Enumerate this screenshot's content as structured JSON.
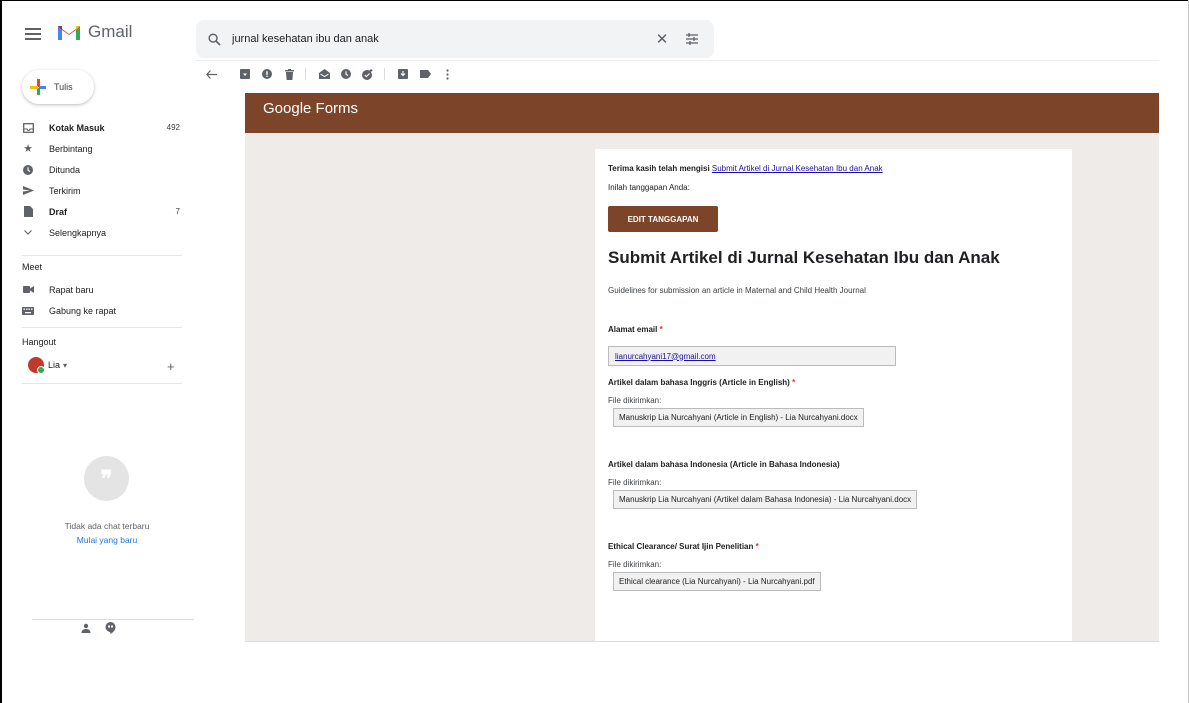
{
  "app": {
    "name": "Gmail"
  },
  "search": {
    "value": "jurnal kesehatan ibu dan anak"
  },
  "sidebar": {
    "compose_label": "Tulis",
    "items": [
      {
        "label": "Kotak Masuk",
        "count": "492",
        "icon": "inbox-icon",
        "bold": true
      },
      {
        "label": "Berbintang",
        "count": "",
        "icon": "star-icon",
        "bold": false
      },
      {
        "label": "Ditunda",
        "count": "",
        "icon": "clock-icon",
        "bold": false
      },
      {
        "label": "Terkirim",
        "count": "",
        "icon": "send-icon",
        "bold": false
      },
      {
        "label": "Draf",
        "count": "7",
        "icon": "draft-icon",
        "bold": true
      },
      {
        "label": "Selengkapnya",
        "count": "",
        "icon": "chevron-down-icon",
        "bold": false
      }
    ],
    "meet": {
      "title": "Meet",
      "items": [
        {
          "label": "Rapat baru",
          "icon": "video-icon"
        },
        {
          "label": "Gabung ke rapat",
          "icon": "keyboard-icon"
        }
      ]
    },
    "hangout": {
      "title": "Hangout",
      "user": "Lia",
      "no_chat": "Tidak ada chat terbaru",
      "start_new": "Mulai yang baru"
    }
  },
  "form": {
    "brand": "Google Forms",
    "thanks_text": "Terima kasih telah mengisi ",
    "thanks_link": "Submit Artikel di Jurnal Kesehatan Ibu dan Anak",
    "response_label": "Inilah tanggapan Anda:",
    "edit_button": "EDIT TANGGAPAN",
    "title": "Submit Artikel di Jurnal Kesehatan Ibu dan Anak",
    "description": "Guidelines for submission an article in Maternal and Child Health Journal",
    "required_mark": "*",
    "sent_label": "File dikirimkan:",
    "email_label": "Alamat email",
    "email_value": "lianurcahyani17@gmail.com",
    "q1_label": "Artikel dalam bahasa Inggris (Article in English)",
    "q1_file": "Manuskrip Lia Nurcahyani (Article in English) - Lia Nurcahyani.docx",
    "q2_label": "Artikel dalam bahasa Indonesia (Article in Bahasa Indonesia)",
    "q2_file": "Manuskrip Lia Nurcahyani (Artikel dalam Bahasa Indonesia) - Lia Nurcahyani.docx",
    "q3_label": "Ethical Clearance/ Surat Ijin Penelitian",
    "q3_file": "Ethical clearance (Lia Nurcahyani) - Lia Nurcahyani.pdf"
  },
  "colors": {
    "brand_brown": "#7c4428",
    "form_bg": "#efebe9",
    "link": "#1a0dab"
  }
}
